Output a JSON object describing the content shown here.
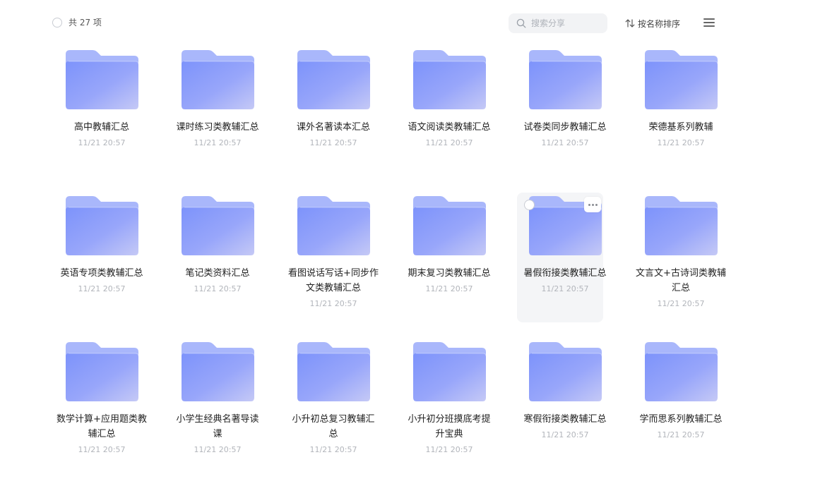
{
  "header": {
    "count_text": "共 27 项",
    "search_placeholder": "搜索分享",
    "sort_label": "按名称排序"
  },
  "folders": [
    {
      "name": "高中教辅汇总",
      "time": "11/21 20:57"
    },
    {
      "name": "课时练习类教辅汇总",
      "time": "11/21 20:57"
    },
    {
      "name": "课外名著读本汇总",
      "time": "11/21 20:57"
    },
    {
      "name": "语文阅读类教辅汇总",
      "time": "11/21 20:57"
    },
    {
      "name": "试卷类同步教辅汇总",
      "time": "11/21 20:57"
    },
    {
      "name": "荣德基系列教辅",
      "time": "11/21 20:57"
    },
    {
      "name": "英语专项类教辅汇总",
      "time": "11/21 20:57"
    },
    {
      "name": "笔记类资料汇总",
      "time": "11/21 20:57"
    },
    {
      "name": "看图说话写话+同步作文类教辅汇总",
      "time": "11/21 20:57"
    },
    {
      "name": "期末复习类教辅汇总",
      "time": "11/21 20:57"
    },
    {
      "name": "暑假衔接类教辅汇总",
      "time": "11/21 20:57"
    },
    {
      "name": "文言文+古诗词类教辅汇总",
      "time": "11/21 20:57"
    },
    {
      "name": "数学计算+应用题类教辅汇总",
      "time": "11/21 20:57"
    },
    {
      "name": "小学生经典名著导读课",
      "time": "11/21 20:57"
    },
    {
      "name": "小升初总复习教辅汇总",
      "time": "11/21 20:57"
    },
    {
      "name": "小升初分班摸底考提升宝典",
      "time": "11/21 20:57"
    },
    {
      "name": "寒假衔接类教辅汇总",
      "time": "11/21 20:57"
    },
    {
      "name": "学而思系列教辅汇总",
      "time": "11/21 20:57"
    }
  ],
  "hovered_index": 10,
  "icons": {
    "select": "circle-checkbox-icon",
    "search": "search-icon",
    "sort": "sort-arrows-icon",
    "menu": "list-view-icon",
    "folder": "folder-icon",
    "more": "more-dots-icon"
  },
  "colors": {
    "folder_back": "#a9b7fb",
    "folder_front_start": "#7d93fb",
    "folder_front_end": "#c5c9f6",
    "hover_bg": "#f4f5f7"
  }
}
